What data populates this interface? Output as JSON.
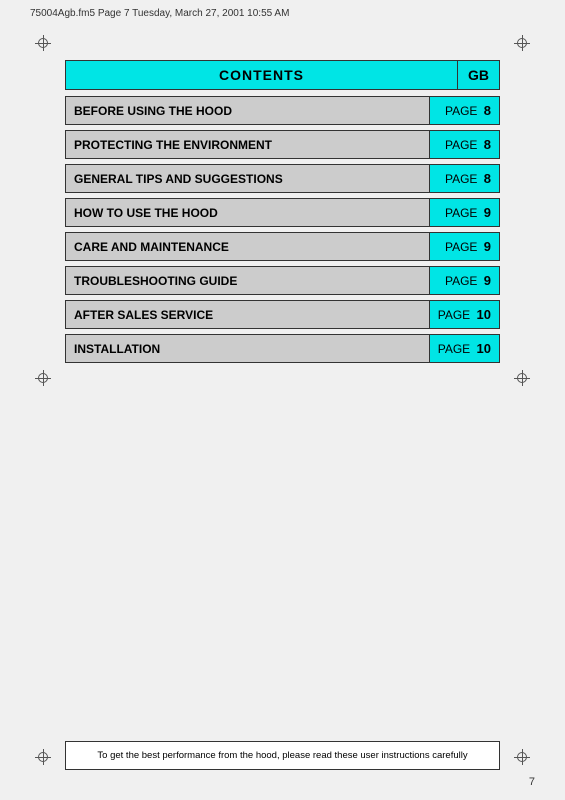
{
  "header": {
    "file_info": "75004Agb.fm5  Page 7  Tuesday, March 27, 2001  10:55 AM"
  },
  "contents": {
    "title": "CONTENTS",
    "gb_label": "GB",
    "rows": [
      {
        "label": "BEFORE USING THE HOOD",
        "page_prefix": "PAGE",
        "page_num": "8"
      },
      {
        "label": "PROTECTING THE ENVIRONMENT",
        "page_prefix": "PAGE",
        "page_num": "8"
      },
      {
        "label": "GENERAL TIPS AND SUGGESTIONS",
        "page_prefix": "PAGE",
        "page_num": "8"
      },
      {
        "label": "HOW TO USE THE HOOD",
        "page_prefix": "PAGE",
        "page_num": "9"
      },
      {
        "label": "CARE AND MAINTENANCE",
        "page_prefix": "PAGE",
        "page_num": "9"
      },
      {
        "label": "TROUBLESHOOTING GUIDE",
        "page_prefix": "PAGE",
        "page_num": "9"
      },
      {
        "label": "AFTER SALES SERVICE",
        "page_prefix": "PAGE",
        "page_num": "10"
      },
      {
        "label": "INSTALLATION",
        "page_prefix": "PAGE",
        "page_num": "10"
      }
    ]
  },
  "bottom_note": {
    "text": "To get the best performance from the hood, please read these user instructions carefully"
  },
  "page_number": "7"
}
